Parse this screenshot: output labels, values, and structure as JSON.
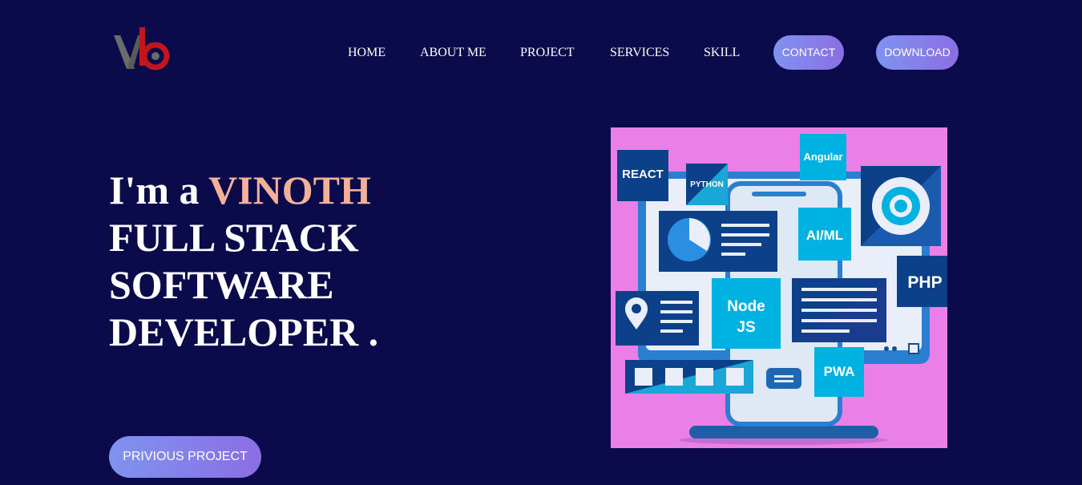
{
  "brand": {
    "logo_text": "vb",
    "logo_colors": [
      "#6b6b6b",
      "#c0161d"
    ]
  },
  "nav": {
    "links": [
      "HOME",
      "ABOUT ME",
      "PROJECT",
      "SERVICES",
      "SKILL"
    ],
    "contact_label": "CONTACT",
    "download_label": "DOWNLOAD"
  },
  "hero": {
    "prefix": "I'm a ",
    "name": "VINOTH",
    "line2": "FULL STACK",
    "line3": "SOFTWARE",
    "line4": "DEVELOPER ."
  },
  "cta": {
    "label": "PRIVIOUS PROJECT"
  },
  "illustration": {
    "tags": [
      "REACT",
      "PYTHON",
      "Angular",
      "AI/ML",
      "PHP",
      "Node",
      "JS",
      "PWA"
    ]
  },
  "colors": {
    "background": "#0b0a4b",
    "accent": "#f4b19a",
    "button_gradient": [
      "#7f93f0",
      "#8b6ee4"
    ],
    "illustration_bg": "#ea7fe8"
  }
}
